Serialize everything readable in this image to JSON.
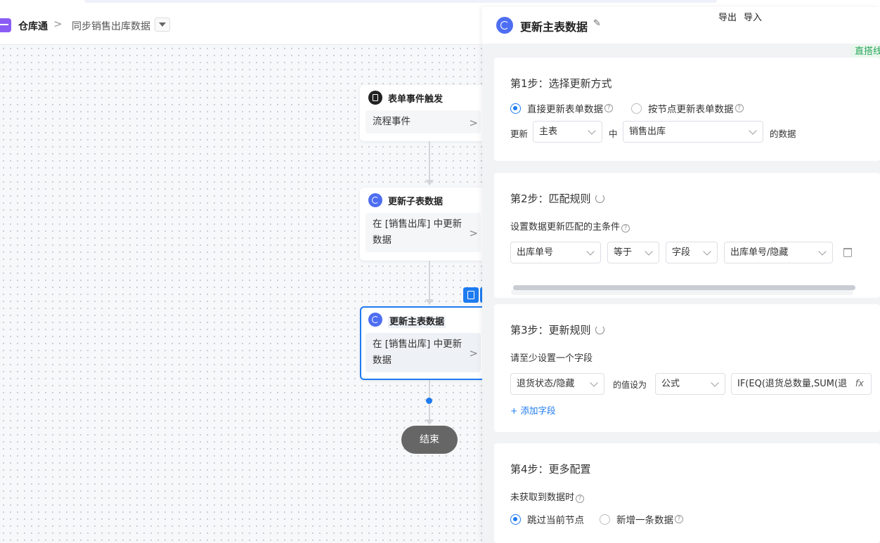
{
  "breadcrumb": {
    "app_name": "仓库通",
    "separator": ">",
    "page_name": "同步销售出库数据"
  },
  "header_actions": {
    "export_label": "导出",
    "import_label": "导入"
  },
  "flow": {
    "nodes": [
      {
        "title": "表单事件触发",
        "body": "流程事件",
        "icon": "form-icon"
      },
      {
        "title": "更新子表数据",
        "body": "在 [销售出库] 中更新数据",
        "icon": "sync-icon"
      },
      {
        "title": "更新主表数据",
        "body": "在 [销售出库] 中更新数据",
        "icon": "sync-icon",
        "active": true
      }
    ],
    "end_label": "结束",
    "chevron": ">"
  },
  "panel": {
    "title": "更新主表数据",
    "badge": "直搭线",
    "edit_glyph": "✎",
    "help_glyph": "?",
    "step1": {
      "title": "第1步：选择更新方式",
      "option_direct": "直接更新表单数据",
      "option_node": "按节点更新表单数据",
      "update_label": "更新",
      "table_select": "主表",
      "in_label": "中",
      "form_select": "销售出库",
      "suffix_label": "的数据"
    },
    "step2": {
      "title": "第2步：匹配规则",
      "subtitle": "设置数据更新匹配的主条件",
      "field_select": "出库单号",
      "operator_select": "等于",
      "type_select": "字段",
      "value_select": "出库单号/隐藏"
    },
    "step3": {
      "title": "第3步：更新规则",
      "subtitle": "请至少设置一个字段",
      "field_select": "退货状态/隐藏",
      "set_label": "的值设为",
      "mode_select": "公式",
      "formula_value": "IF(EQ(退货总数量,SUM(退",
      "fx_label": "fx",
      "add_field": "+ 添加字段"
    },
    "step4": {
      "title": "第4步：更多配置",
      "subtitle": "未获取到数据时",
      "option_skip": "跳过当前节点",
      "option_add": "新增一条数据"
    }
  }
}
